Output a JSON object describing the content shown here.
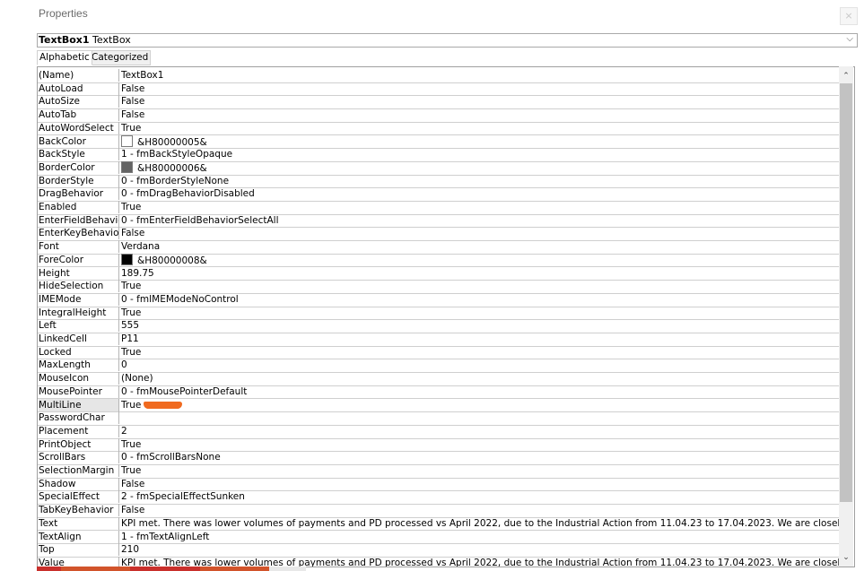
{
  "window": {
    "title": "Properties",
    "close_label": "×"
  },
  "object_selector": {
    "name": "TextBox1",
    "type": " TextBox",
    "arrow": "⌵"
  },
  "tabs": [
    {
      "label": "Alphabetic",
      "active": true
    },
    {
      "label": "Categorized",
      "active": false
    }
  ],
  "properties": [
    {
      "name": "(Name)",
      "value": "TextBox1"
    },
    {
      "name": "AutoLoad",
      "value": "False"
    },
    {
      "name": "AutoSize",
      "value": "False"
    },
    {
      "name": "AutoTab",
      "value": "False"
    },
    {
      "name": "AutoWordSelect",
      "value": "True"
    },
    {
      "name": "BackColor",
      "value": "&H80000005&",
      "swatch": "#ffffff"
    },
    {
      "name": "BackStyle",
      "value": "1 - fmBackStyleOpaque"
    },
    {
      "name": "BorderColor",
      "value": "&H80000006&",
      "swatch": "#646464"
    },
    {
      "name": "BorderStyle",
      "value": "0 - fmBorderStyleNone"
    },
    {
      "name": "DragBehavior",
      "value": "0 - fmDragBehaviorDisabled"
    },
    {
      "name": "Enabled",
      "value": "True"
    },
    {
      "name": "EnterFieldBehavior",
      "value": "0 - fmEnterFieldBehaviorSelectAll"
    },
    {
      "name": "EnterKeyBehavior",
      "value": "False"
    },
    {
      "name": "Font",
      "value": "Verdana"
    },
    {
      "name": "ForeColor",
      "value": "&H80000008&",
      "swatch": "#000000"
    },
    {
      "name": "Height",
      "value": "189.75"
    },
    {
      "name": "HideSelection",
      "value": "True"
    },
    {
      "name": "IMEMode",
      "value": "0 - fmIMEModeNoControl"
    },
    {
      "name": "IntegralHeight",
      "value": "True"
    },
    {
      "name": "Left",
      "value": "555"
    },
    {
      "name": "LinkedCell",
      "value": "P11"
    },
    {
      "name": "Locked",
      "value": "True"
    },
    {
      "name": "MaxLength",
      "value": "0"
    },
    {
      "name": "MouseIcon",
      "value": "(None)"
    },
    {
      "name": "MousePointer",
      "value": "0 - fmMousePointerDefault"
    },
    {
      "name": "MultiLine",
      "value": "True",
      "selected": true
    },
    {
      "name": "PasswordChar",
      "value": ""
    },
    {
      "name": "Placement",
      "value": "2"
    },
    {
      "name": "PrintObject",
      "value": "True"
    },
    {
      "name": "ScrollBars",
      "value": "0 - fmScrollBarsNone"
    },
    {
      "name": "SelectionMargin",
      "value": "True"
    },
    {
      "name": "Shadow",
      "value": "False"
    },
    {
      "name": "SpecialEffect",
      "value": "2 - fmSpecialEffectSunken"
    },
    {
      "name": "TabKeyBehavior",
      "value": "False"
    },
    {
      "name": "Text",
      "value": "KPI met. There was lower volumes of payments and PD processed vs April 2022, due to the Industrial Action from 11.04.23 to 17.04.2023. We are closely monitoring th"
    },
    {
      "name": "TextAlign",
      "value": "1 - fmTextAlignLeft"
    },
    {
      "name": "Top",
      "value": "210"
    },
    {
      "name": "Value",
      "value": "KPI met. There was lower volumes of payments and PD processed vs April 2022, due to the Industrial Action from 11.04.23 to 17.04.2023. We are closely monitoring th"
    }
  ],
  "scrollbar": {
    "up_arrow": "⌃",
    "down_arrow": "⌄"
  },
  "colors": {
    "annotation": "#f06a1f",
    "taskbar": [
      "#c9302c",
      "#d2542b",
      "#c9302c",
      "#d2542b",
      "#e8e8e8"
    ]
  }
}
